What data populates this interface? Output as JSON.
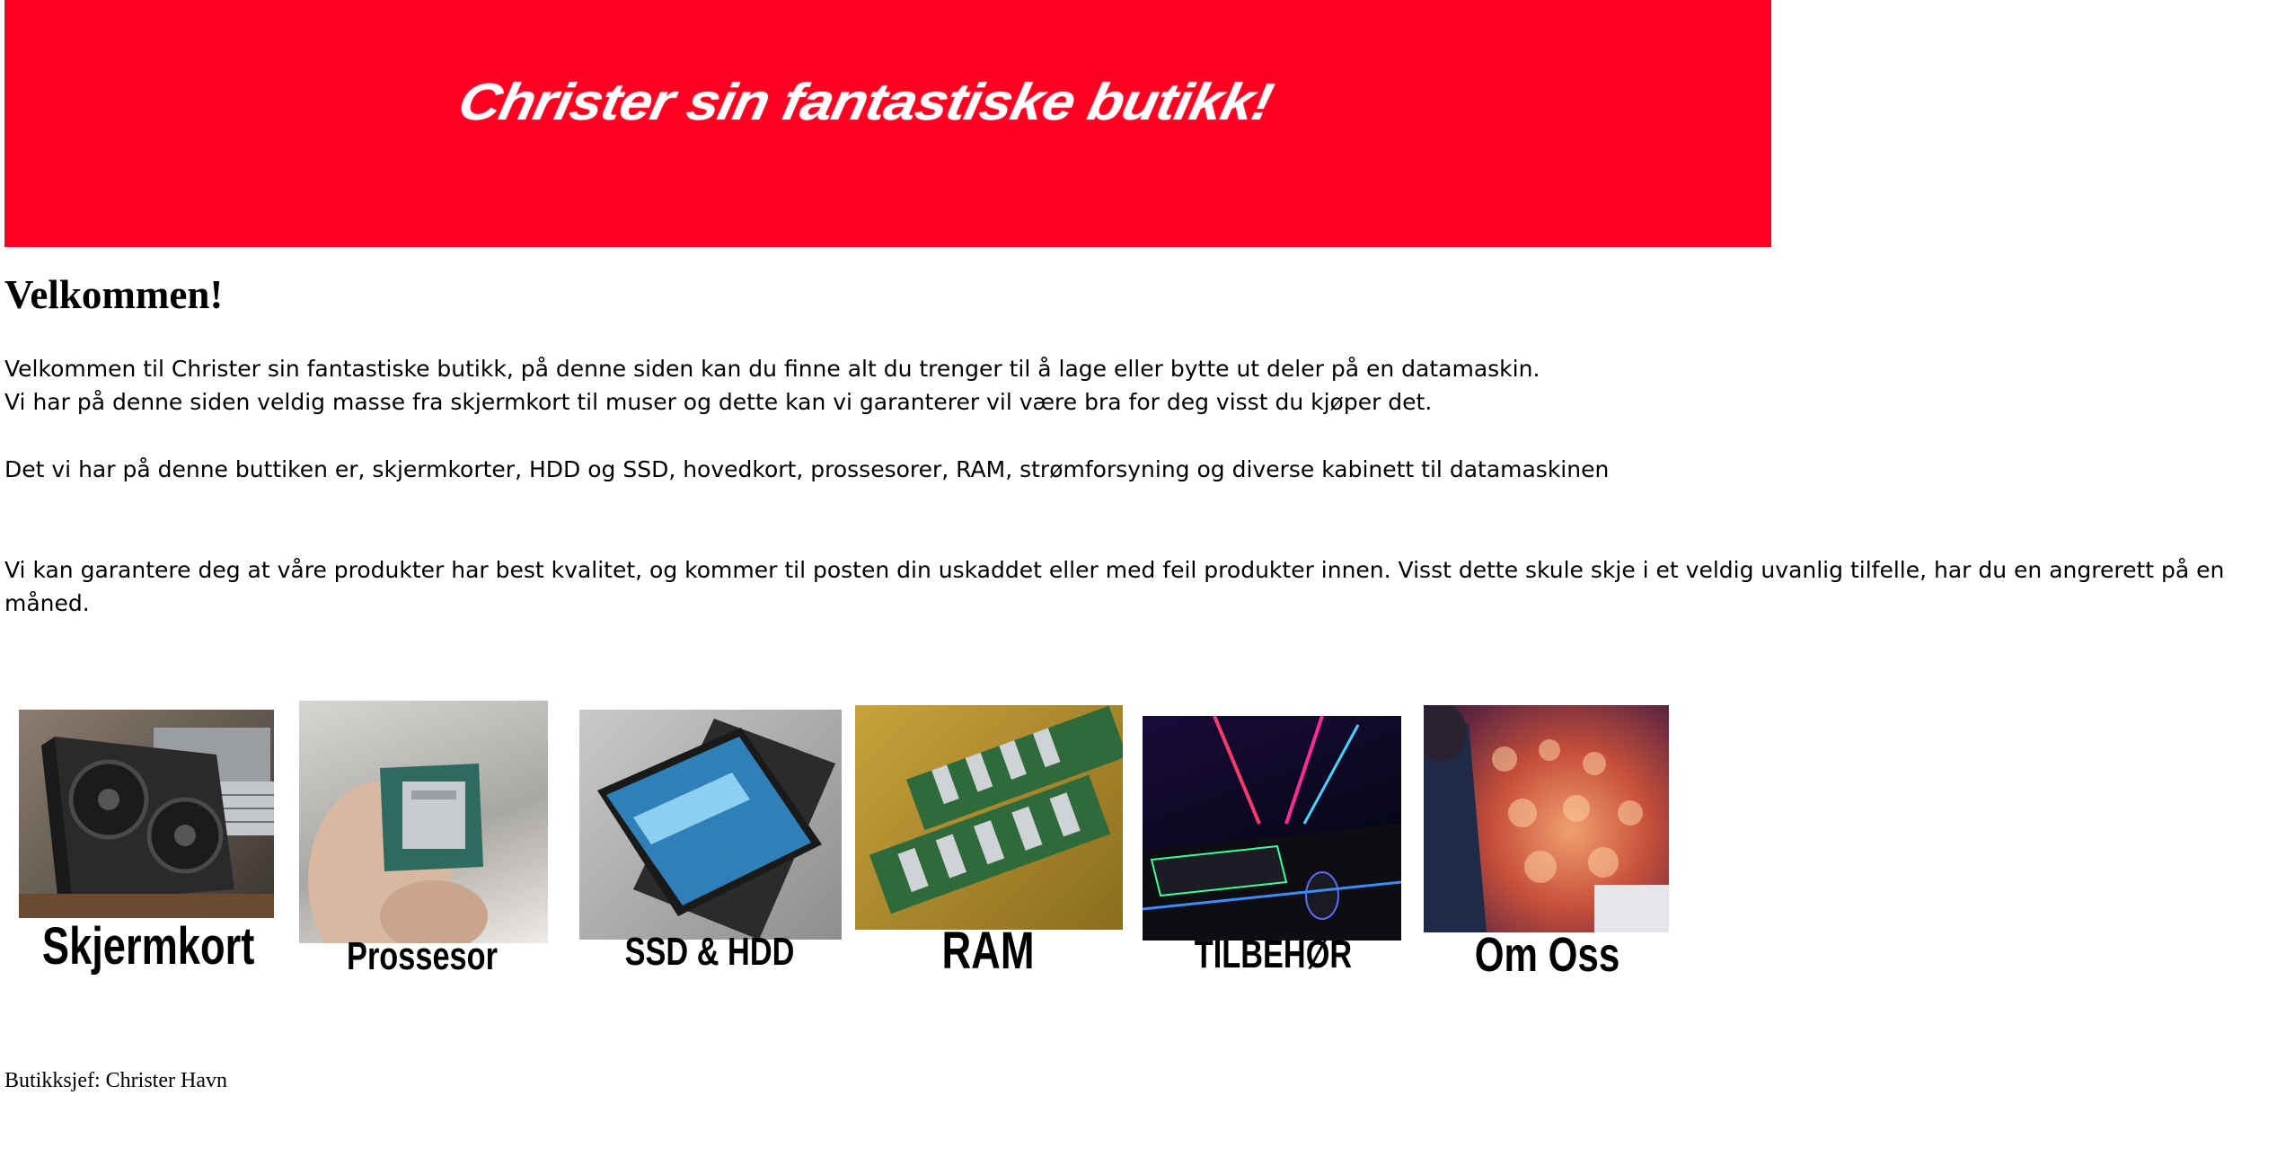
{
  "banner": {
    "title": "Christer sin fantastiske butikk!"
  },
  "welcome": {
    "heading": "Velkommen!",
    "line1": "Velkommen til Christer sin fantastiske butikk, på denne siden kan du finne alt du trenger til å lage eller bytte ut deler på en datamaskin.",
    "line2": "Vi har på denne siden veldig masse fra skjermkort til muser og dette kan vi garanterer vil være bra for deg visst du kjøper det.",
    "line3": "Det vi har på denne buttiken er, skjermkorter, HDD og SSD, hovedkort, prossesorer, RAM, strømforsyning og diverse kabinett til datamaskinen",
    "line4": "Vi kan garantere deg at våre produkter har best kvalitet, og kommer til posten din uskaddet eller med feil produkter innen. Visst dette skule skje i et veldig uvanlig tilfelle, har du en angrerett på en måned."
  },
  "products": [
    {
      "label": "Skjermkort",
      "icon": "graphics-card-icon"
    },
    {
      "label": "Prossesor",
      "icon": "processor-icon"
    },
    {
      "label": "SSD & HDD",
      "icon": "ssd-icon"
    },
    {
      "label": "RAM",
      "icon": "ram-icon"
    },
    {
      "label": "TILBEHØR",
      "icon": "accessories-icon"
    },
    {
      "label": "Om Oss",
      "icon": "audience-icon"
    }
  ],
  "footer": {
    "text": "Butikksjef: Christer Havn"
  },
  "colors": {
    "banner": "#ff0022",
    "text": "#000000"
  }
}
